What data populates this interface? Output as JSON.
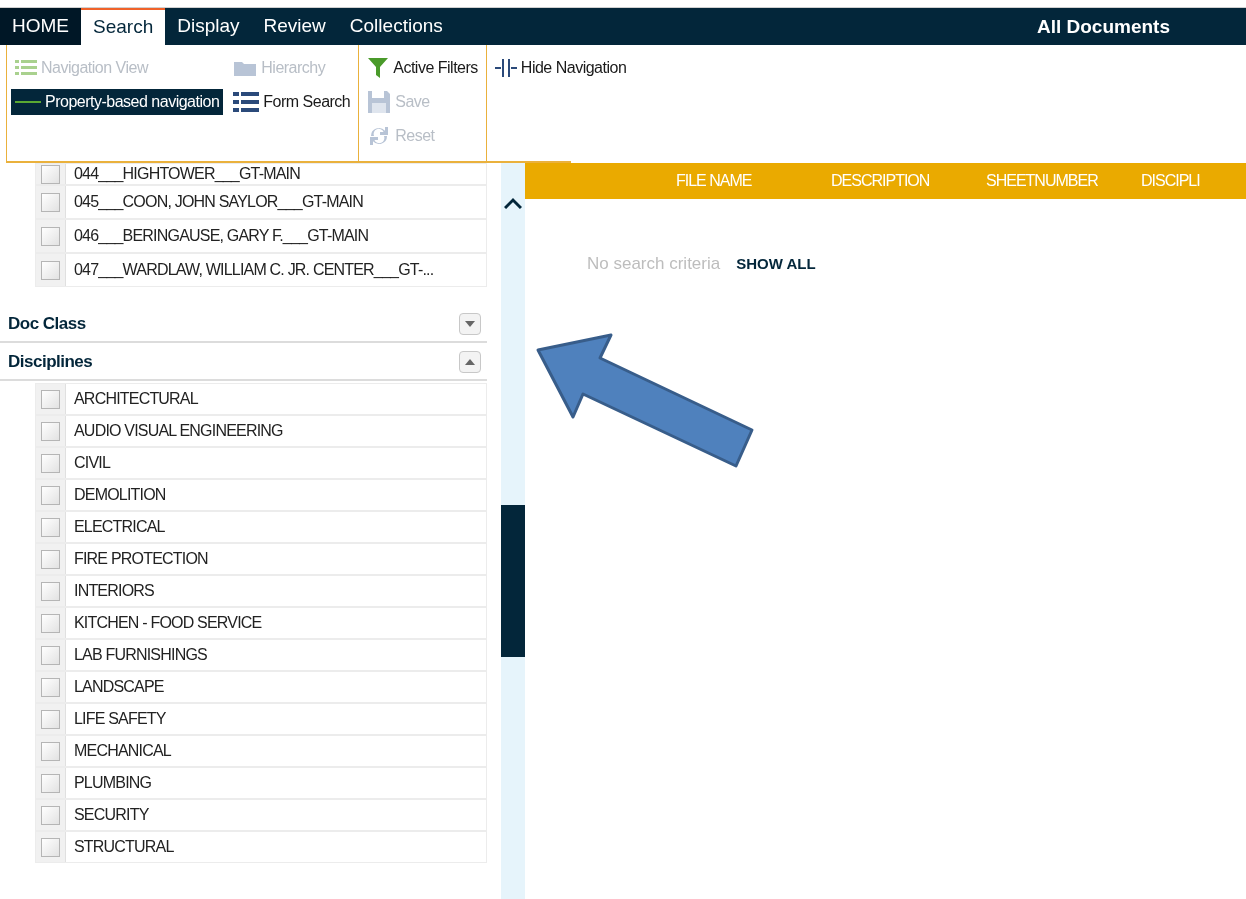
{
  "top_bar": {
    "tabs": [
      {
        "label": "HOME",
        "selected": false
      },
      {
        "label": "Search",
        "selected": true
      },
      {
        "label": "Display",
        "selected": false
      },
      {
        "label": "Review",
        "selected": false
      },
      {
        "label": "Collections",
        "selected": false
      }
    ],
    "title": "All Documents"
  },
  "ribbon": {
    "groups": [
      {
        "kind": "grid",
        "items": [
          {
            "label": "Navigation View",
            "kind": "list",
            "disabled": true,
            "selected": false
          },
          {
            "label": "Hierarchy",
            "kind": "folder",
            "disabled": true,
            "selected": false
          },
          {
            "label": "Property-based navigation",
            "kind": "line",
            "disabled": false,
            "selected": true
          },
          {
            "label": "Form Search",
            "kind": "form",
            "disabled": false,
            "selected": false
          }
        ]
      },
      {
        "kind": "column",
        "items": [
          {
            "label": "Active Filters",
            "kind": "funnel",
            "disabled": false,
            "selected": false
          },
          {
            "label": "Save",
            "kind": "floppy",
            "disabled": true,
            "selected": false
          },
          {
            "label": "Reset",
            "kind": "refresh",
            "disabled": true,
            "selected": false
          }
        ]
      },
      {
        "kind": "column",
        "items": [
          {
            "label": "Hide Navigation",
            "kind": "collapse",
            "disabled": false,
            "selected": false
          }
        ]
      }
    ]
  },
  "navigation": {
    "locations": [
      {
        "label": "044___HIGHTOWER___GT-MAIN",
        "checked": false
      },
      {
        "label": "045___COON, JOHN SAYLOR___GT-MAIN",
        "checked": false
      },
      {
        "label": "046___BERINGAUSE, GARY F.___GT-MAIN",
        "checked": false
      },
      {
        "label": "047___WARDLAW, WILLIAM C. JR. CENTER___GT-...",
        "checked": false
      }
    ],
    "sections": [
      {
        "title": "Doc Class",
        "expanded": false
      },
      {
        "title": "Disciplines",
        "expanded": true,
        "items": [
          {
            "label": "ARCHITECTURAL",
            "checked": false
          },
          {
            "label": "AUDIO VISUAL ENGINEERING",
            "checked": false
          },
          {
            "label": "CIVIL",
            "checked": false
          },
          {
            "label": "DEMOLITION",
            "checked": false
          },
          {
            "label": "ELECTRICAL",
            "checked": false
          },
          {
            "label": "FIRE PROTECTION",
            "checked": false
          },
          {
            "label": "INTERIORS",
            "checked": false
          },
          {
            "label": "KITCHEN - FOOD SERVICE",
            "checked": false
          },
          {
            "label": "LAB FURNISHINGS",
            "checked": false
          },
          {
            "label": "LANDSCAPE",
            "checked": false
          },
          {
            "label": "LIFE SAFETY",
            "checked": false
          },
          {
            "label": "MECHANICAL",
            "checked": false
          },
          {
            "label": "PLUMBING",
            "checked": false
          },
          {
            "label": "SECURITY",
            "checked": false
          },
          {
            "label": "STRUCTURAL",
            "checked": false
          }
        ]
      }
    ]
  },
  "results": {
    "columns": [
      "FILE NAME",
      "DESCRIPTION",
      "SHEETNUMBER",
      "DISCIPLI"
    ],
    "empty_message": "No search criteria",
    "action": "SHOW ALL"
  }
}
